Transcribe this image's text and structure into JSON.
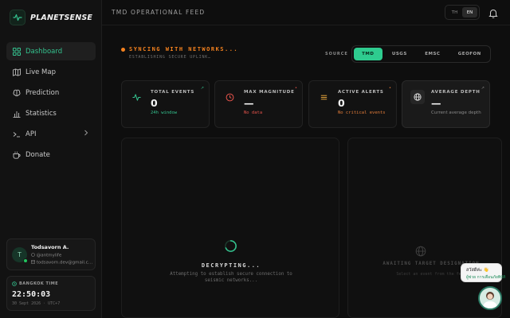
{
  "brand": {
    "name": "PLANETSENSE"
  },
  "sidebar": {
    "items": [
      {
        "label": "Dashboard",
        "icon": "grid-icon"
      },
      {
        "label": "Live Map",
        "icon": "map-icon"
      },
      {
        "label": "Prediction",
        "icon": "brain-icon"
      },
      {
        "label": "Statistics",
        "icon": "bar-chart-icon"
      },
      {
        "label": "API",
        "icon": "terminal-icon"
      },
      {
        "label": "Donate",
        "icon": "coffee-icon"
      }
    ],
    "active_index": 0
  },
  "user": {
    "initial": "T",
    "name": "Todsavorn A.",
    "handle": "@antmylife",
    "email": "todsavorn.dev@gmail.c…"
  },
  "clock": {
    "label": "BANGKOK TIME",
    "time": "22:50:03",
    "date": "30 Sept 2026 · UTC+7"
  },
  "header": {
    "title": "TMD OPERATIONAL FEED",
    "languages": [
      "TH",
      "EN"
    ],
    "active_language": "EN"
  },
  "sync": {
    "title": "SYNCING WITH NETWORKS...",
    "subtitle": "ESTABLISHING SECURE UPLINK…",
    "status_color": "#f5821f"
  },
  "source": {
    "label": "SOURCE",
    "tabs": [
      "TMD",
      "USGS",
      "EMSC",
      "GEOFON"
    ],
    "active": "TMD",
    "accent": "#2ecc8f"
  },
  "stats": [
    {
      "label": "TOTAL EVENTS",
      "value": "0",
      "sub": "24h window",
      "sub_color": "#34c38f",
      "icon": "activity-icon"
    },
    {
      "label": "MAX MAGNITUDE",
      "value": "—",
      "sub": "No data",
      "sub_color": "#e5534b",
      "icon": "gauge-icon"
    },
    {
      "label": "ACTIVE ALERTS",
      "value": "0",
      "sub": "No critical events",
      "sub_color": "#e07b39",
      "icon": "layers-icon"
    },
    {
      "label": "AVERAGE DEPTH",
      "value": "—",
      "sub": "Current average depth",
      "sub_color": "#8a8a8a",
      "icon": "globe-icon"
    }
  ],
  "loading_panel": {
    "title": "DECRYPTING...",
    "subtitle": "Attempting to establish secure connection to seismic networks..."
  },
  "detail_panel": {
    "title": "AWAITING TARGET DESIGNATION",
    "subtitle": "Select an event from the feed"
  },
  "chat": {
    "greeting": "สวัสดีค่ะ 👋",
    "line2": "ผู้ช่วย การเตือนภัยพิบัติ"
  }
}
